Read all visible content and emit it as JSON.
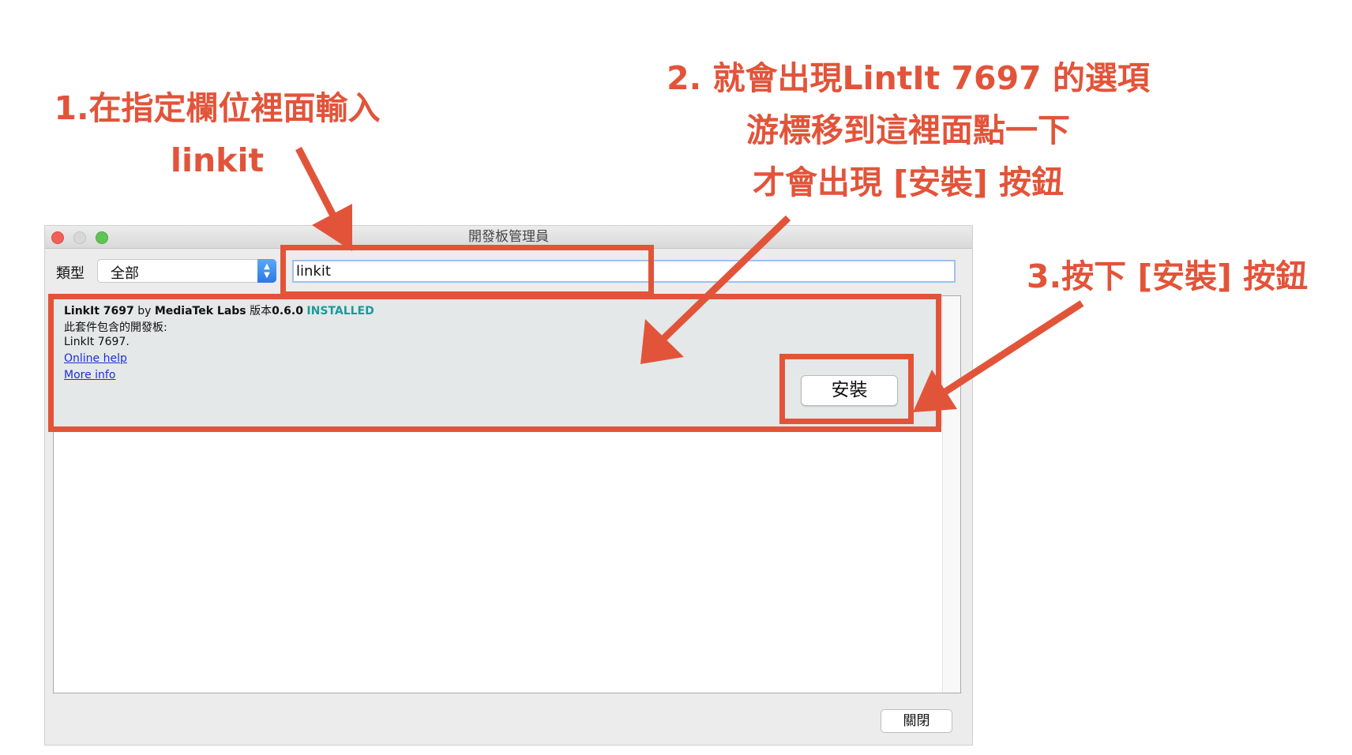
{
  "annotations": {
    "step1": [
      "1.在指定欄位裡面輸入",
      "linkit"
    ],
    "step2": [
      "2. 就會出現LintIt 7697 的選項",
      "游標移到這裡面點一下",
      "才會出現 [安裝] 按鈕"
    ],
    "step3": [
      "3.按下 [安裝] 按鈕"
    ],
    "accent_color": "#e2543a"
  },
  "window": {
    "title": "開發板管理員",
    "type_label": "類型",
    "type_value": "全部",
    "search_value": "linkit"
  },
  "entry": {
    "name": "LinkIt 7697",
    "by": " by ",
    "author": "MediaTek Labs",
    "version_label": " 版本",
    "version": "0.6.0",
    "status": "INSTALLED",
    "contains_label": "此套件包含的開發板:",
    "boards": "LinkIt 7697.",
    "online_help": "Online help",
    "more_info": "More info"
  },
  "buttons": {
    "install": "安裝",
    "close": "關閉"
  },
  "icons": {
    "close": "traffic-close-icon",
    "minimize": "traffic-minimize-icon",
    "zoom": "traffic-zoom-icon",
    "select_arrows": "chevron-up-down-icon"
  }
}
